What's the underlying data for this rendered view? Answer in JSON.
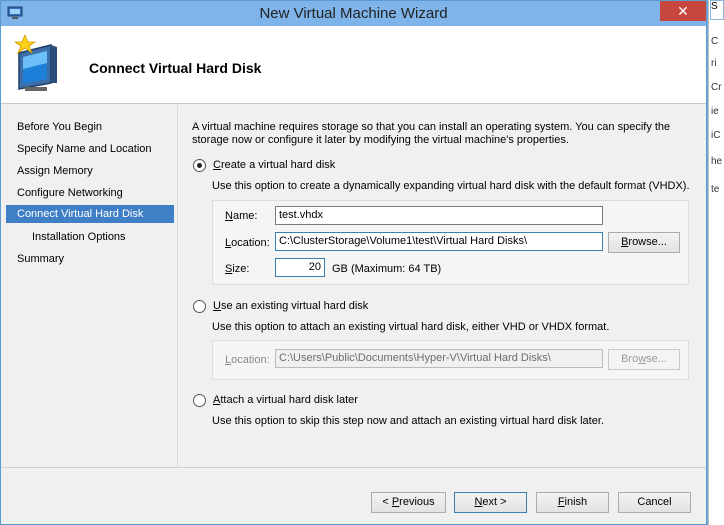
{
  "window": {
    "title": "New Virtual Machine Wizard",
    "close_glyph": "✕"
  },
  "header": {
    "title": "Connect Virtual Hard Disk"
  },
  "nav": {
    "items": [
      {
        "label": "Before You Begin"
      },
      {
        "label": "Specify Name and Location"
      },
      {
        "label": "Assign Memory"
      },
      {
        "label": "Configure Networking"
      },
      {
        "label": "Connect Virtual Hard Disk"
      },
      {
        "label": "Installation Options"
      },
      {
        "label": "Summary"
      }
    ]
  },
  "content": {
    "intro": "A virtual machine requires storage so that you can install an operating system. You can specify the storage now or configure it later by modifying the virtual machine's properties.",
    "option_create": {
      "label_underlined": "C",
      "label_rest": "reate a virtual hard disk",
      "description": "Use this option to create a dynamically expanding virtual hard disk with the default format (VHDX).",
      "name_label_underlined": "N",
      "name_label_rest": "ame:",
      "name_value": "test.vhdx",
      "location_label_underlined": "L",
      "location_label_rest": "ocation:",
      "location_value": "C:\\ClusterStorage\\Volume1\\test\\Virtual Hard Disks\\",
      "browse_label_underlined": "B",
      "browse_label_rest": "rowse...",
      "size_label_underlined": "S",
      "size_label_rest": "ize:",
      "size_value": "20",
      "size_hint": "GB (Maximum: 64 TB)"
    },
    "option_existing": {
      "label_underlined": "U",
      "label_rest": "se an existing virtual hard disk",
      "description": "Use this option to attach an existing virtual hard disk, either VHD or VHDX format.",
      "location_label_underlined": "L",
      "location_label_rest": "ocation:",
      "location_value": "C:\\Users\\Public\\Documents\\Hyper-V\\Virtual Hard Disks\\",
      "browse_label_underlined": "w",
      "browse_label_pre": "Bro",
      "browse_label_rest": "se..."
    },
    "option_later": {
      "label_underlined": "A",
      "label_rest": "ttach a virtual hard disk later",
      "description": "Use this option to skip this step now and attach an existing virtual hard disk later."
    }
  },
  "footer": {
    "previous_pre": "< ",
    "previous_underlined": "P",
    "previous_rest": "revious",
    "next_underlined": "N",
    "next_rest": "ext >",
    "finish_underlined": "F",
    "finish_rest": "inish",
    "cancel_label": "Cancel"
  },
  "side_strip": {
    "chars": [
      "S",
      "C",
      "ri",
      "Cr",
      "ie",
      "iC",
      "he",
      "te"
    ]
  },
  "colors": {
    "titlebar": "#7eb4ea",
    "nav_active": "#3f7fc6",
    "close": "#c7463e"
  }
}
